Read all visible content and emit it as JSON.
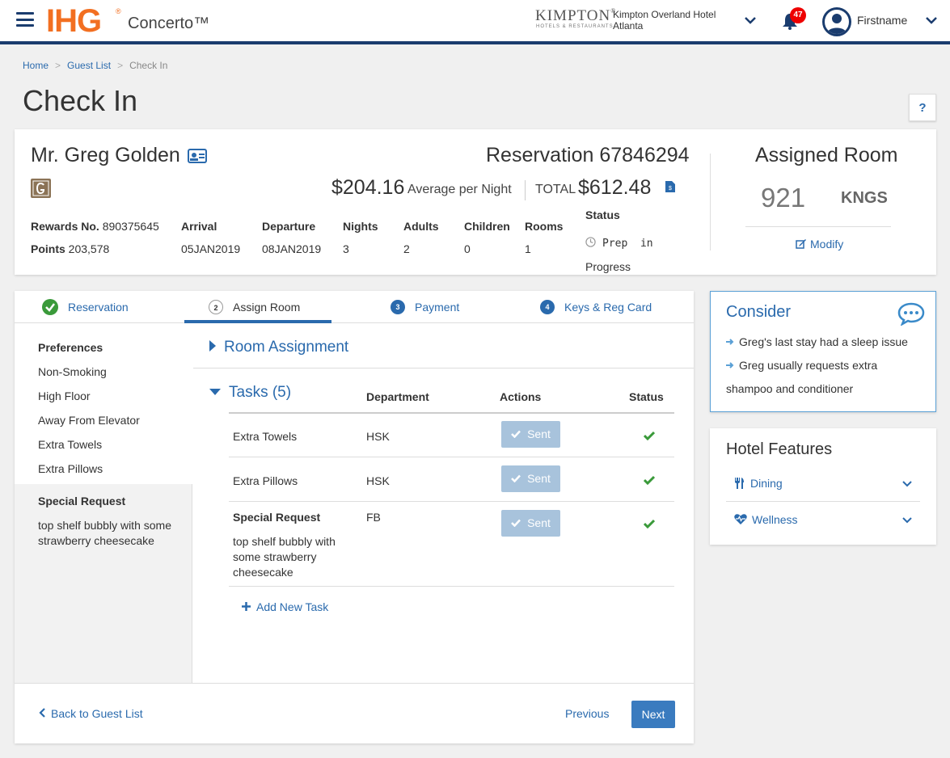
{
  "header": {
    "logo": "IHG",
    "logo_reg": "®",
    "app_name": "Concerto™",
    "brand": "KIMPTON",
    "brand_reg": "®",
    "brand_sub": "HOTELS & RESTAURANTS",
    "hotel_line1": "Kimpton Overland Hotel",
    "hotel_line2": "Atlanta",
    "notification_count": "47",
    "username": "Firstname"
  },
  "breadcrumb": {
    "home": "Home",
    "guest_list": "Guest List",
    "current": "Check In",
    "separator": ">"
  },
  "page_title": "Check In",
  "help_label": "?",
  "reservation": {
    "guest_name": "Mr. Greg Golden",
    "reservation_label": "Reservation 67846294",
    "avg_rate": "$204.16",
    "avg_rate_label": "Average per Night",
    "total_label": "TOTAL",
    "total_value": "$612.48",
    "rewards_label": "Rewards No.",
    "rewards_value": "890375645",
    "points_label": "Points",
    "points_value": "203,578",
    "arrival_label": "Arrival",
    "arrival_value": "05JAN2019",
    "departure_label": "Departure",
    "departure_value": "08JAN2019",
    "nights_label": "Nights",
    "nights_value": "3",
    "adults_label": "Adults",
    "adults_value": "2",
    "children_label": "Children",
    "children_value": "0",
    "rooms_label": "Rooms",
    "rooms_value": "1",
    "status_label": "Status",
    "status_line1": "Prep  in",
    "status_line2": "Progress"
  },
  "assigned_room": {
    "title": "Assigned Room",
    "number": "921",
    "type": "KNGS",
    "modify": "Modify"
  },
  "steps": [
    {
      "num": "",
      "label": "Reservation",
      "state": "done"
    },
    {
      "num": "2",
      "label": "Assign Room",
      "state": "active"
    },
    {
      "num": "3",
      "label": "Payment",
      "state": "todo"
    },
    {
      "num": "4",
      "label": "Keys & Reg Card",
      "state": "todo"
    }
  ],
  "preferences": {
    "title": "Preferences",
    "items": [
      "Non-Smoking",
      "High Floor",
      "Away From Elevator",
      "Extra Towels",
      "Extra Pillows"
    ],
    "special_title": "Special Request",
    "special_line1": "top shelf bubbly with some",
    "special_line2": "strawberry cheesecake"
  },
  "room_assignment_title": "Room Assignment",
  "tasks": {
    "title": "Tasks (5)",
    "col_department": "Department",
    "col_actions": "Actions",
    "col_status": "Status",
    "rows": [
      {
        "name": "Extra Towels",
        "department": "HSK",
        "action": "Sent"
      },
      {
        "name": "Extra Pillows",
        "department": "HSK",
        "action": "Sent"
      },
      {
        "name": "Special Request",
        "department": "FB",
        "action": "Sent",
        "desc1": "top shelf bubbly with",
        "desc2": "some strawberry",
        "desc3": "cheesecake"
      }
    ],
    "add_task": "Add New Task"
  },
  "footer": {
    "back": "Back to Guest List",
    "previous": "Previous",
    "next": "Next"
  },
  "consider": {
    "title": "Consider",
    "item1": "Greg's last stay had a sleep issue",
    "item2_line1": "Greg usually requests extra",
    "item2_line2": "shampoo and conditioner"
  },
  "hotel_features": {
    "title": "Hotel Features",
    "items": [
      "Dining",
      "Wellness"
    ]
  },
  "colors": {
    "navy": "#1a3c6e",
    "ihg_orange": "#f26f21",
    "link_blue": "#2a6aad",
    "success_green": "#3a9a3a",
    "alert_red": "#e00000"
  }
}
